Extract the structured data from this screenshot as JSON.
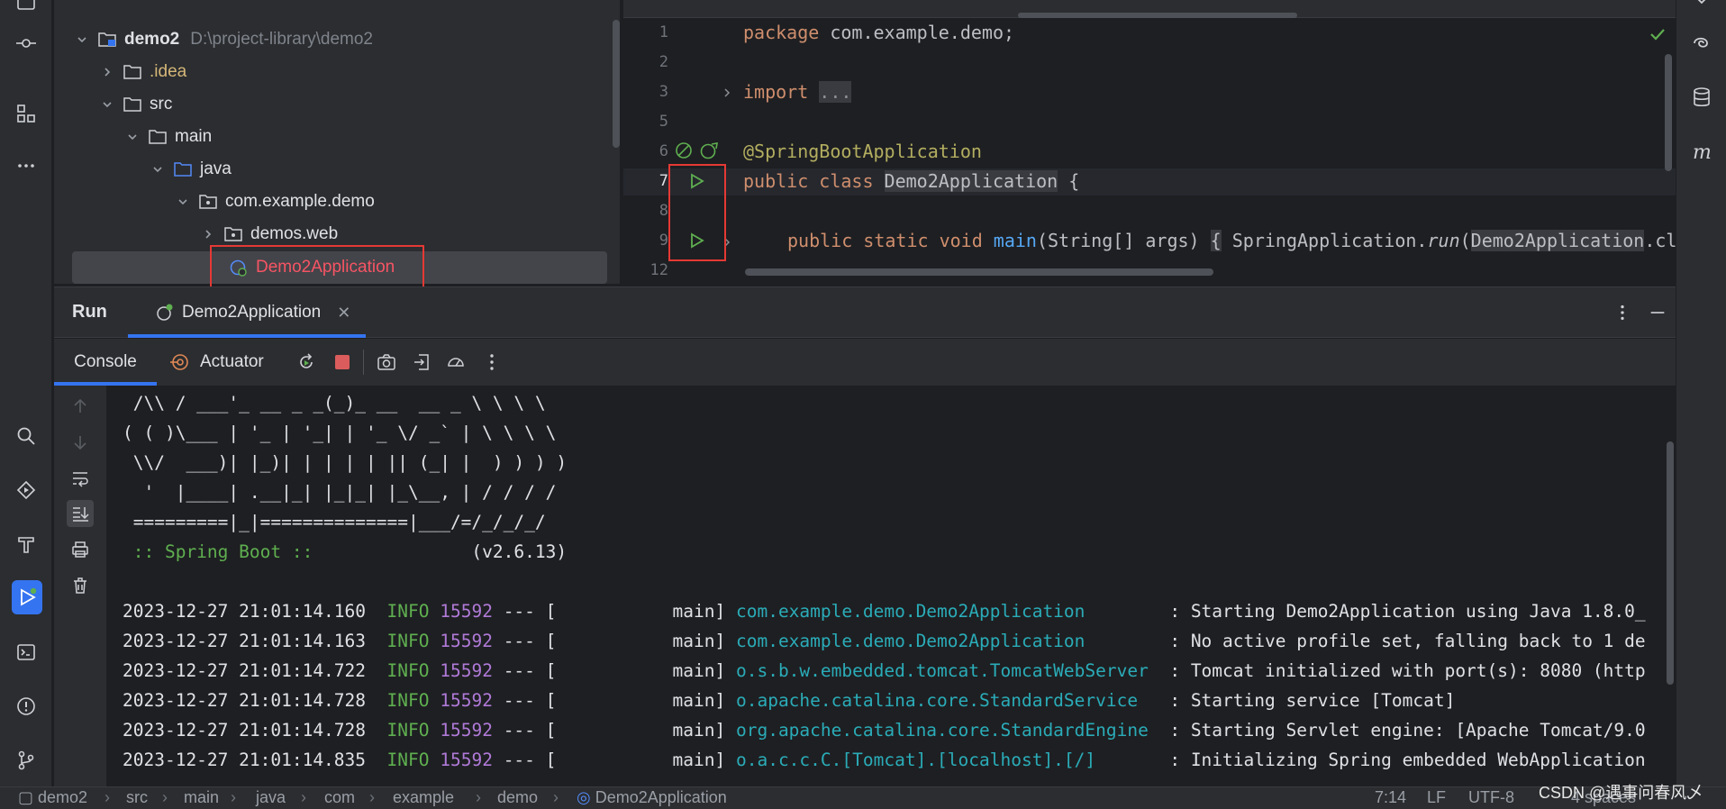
{
  "project_tree": {
    "root": {
      "name": "demo2",
      "path": "D:\\project-library\\demo2"
    },
    "items": [
      {
        "label": ".idea"
      },
      {
        "label": "src"
      },
      {
        "label": "main"
      },
      {
        "label": "java"
      },
      {
        "label": "com.example.demo"
      },
      {
        "label": "demos.web"
      },
      {
        "label": "Demo2Application"
      }
    ]
  },
  "editor": {
    "line_numbers": [
      "1",
      "2",
      "3",
      "5",
      "6",
      "7",
      "8",
      "9",
      "12"
    ],
    "code": {
      "l1_kw": "package",
      "l1_rest": " com.example.demo;",
      "l3_kw": "import",
      "l3_fold": "...",
      "l6_ann": "@SpringBootApplication",
      "l7_kw": "public class",
      "l7_cls": "Demo2Application",
      "l7_brace": " {",
      "l9_kw": "public static void",
      "l9_fn": "main",
      "l9_args": "(String[] args)",
      "l9_open": "{",
      "l9_call": "SpringApplication.",
      "l9_run": "run",
      "l9_arg": "Demo2Application",
      "l9_tail": ".cla"
    }
  },
  "run_panel": {
    "title": "Run",
    "tab_label": "Demo2Application",
    "console_tab": "Console",
    "actuator_tab": "Actuator"
  },
  "console": {
    "banner": [
      " /\\\\ / ___'_ __ _ _(_)_ __  __ _ \\ \\ \\ \\",
      "( ( )\\___ | '_ | '_| | '_ \\/ _` | \\ \\ \\ \\",
      " \\\\/  ___)| |_)| | | | | || (_| |  ) ) ) )",
      "  '  |____| .__|_| |_|_| |_\\__, | / / / /",
      " =========|_|==============|___/=/_/_/_/"
    ],
    "spring_boot_label": " :: Spring Boot :: ",
    "spring_boot_version": "              (v2.6.13)",
    "logs": [
      {
        "ts": "2023-12-27 21:01:14.160",
        "level": "INFO",
        "pid": "15592",
        "sep": "--- [",
        "thread": "           main]",
        "logger": "com.example.demo.Demo2Application       ",
        "msg": " : Starting Demo2Application using Java 1.8.0_"
      },
      {
        "ts": "2023-12-27 21:01:14.163",
        "level": "INFO",
        "pid": "15592",
        "sep": "--- [",
        "thread": "           main]",
        "logger": "com.example.demo.Demo2Application       ",
        "msg": " : No active profile set, falling back to 1 de"
      },
      {
        "ts": "2023-12-27 21:01:14.722",
        "level": "INFO",
        "pid": "15592",
        "sep": "--- [",
        "thread": "           main]",
        "logger": "o.s.b.w.embedded.tomcat.TomcatWebServer ",
        "msg": " : Tomcat initialized with port(s): 8080 (http"
      },
      {
        "ts": "2023-12-27 21:01:14.728",
        "level": "INFO",
        "pid": "15592",
        "sep": "--- [",
        "thread": "           main]",
        "logger": "o.apache.catalina.core.StandardService  ",
        "msg": " : Starting service [Tomcat]"
      },
      {
        "ts": "2023-12-27 21:01:14.728",
        "level": "INFO",
        "pid": "15592",
        "sep": "--- [",
        "thread": "           main]",
        "logger": "org.apache.catalina.core.StandardEngine ",
        "msg": " : Starting Servlet engine: [Apache Tomcat/9.0"
      },
      {
        "ts": "2023-12-27 21:01:14.835",
        "level": "INFO",
        "pid": "15592",
        "sep": "--- [",
        "thread": "           main]",
        "logger": "o.a.c.c.C.[Tomcat].[localhost].[/]      ",
        "msg": " : Initializing Spring embedded WebApplication"
      }
    ]
  },
  "status_bar": {
    "breadcrumbs": [
      "demo2",
      "src",
      "main",
      "java",
      "com",
      "example",
      "demo",
      "Demo2Application"
    ],
    "position": "7:14",
    "line_ending": "LF",
    "encoding": "UTF-8",
    "indent": "4 spaces"
  },
  "watermark": "CSDN @遇事问春风乄",
  "colors": {
    "accent": "#3574f0",
    "highlight_box": "#e53935",
    "run_green": "#5faf50"
  }
}
